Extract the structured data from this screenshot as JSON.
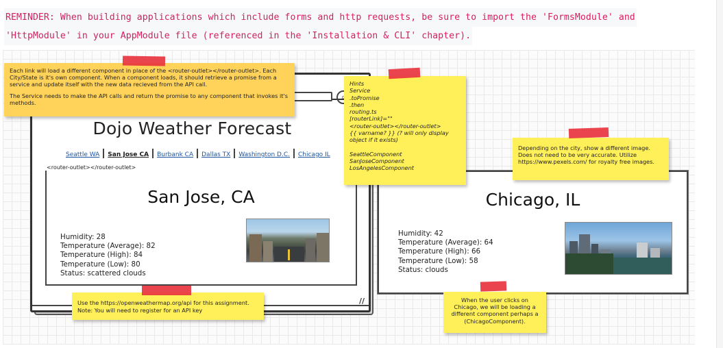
{
  "reminder": {
    "line1": "REMINDER: When building applications which include forms and http requests, be sure to import the 'FormsModule' and",
    "line2": "'HttpModule' in your AppModule file (referenced in the 'Installation & CLI' chapter)."
  },
  "wireframe": {
    "site_title": "Dojo Weather Forecast",
    "nav_links": [
      "Seattle WA",
      "San Jose CA",
      "Burbank CA",
      "Dallas TX",
      "Washington D.C.",
      "Chicago IL"
    ],
    "active_link": "San Jose CA",
    "outlet_label": "<router-outlet></router-outlet>",
    "search_glyph": "⌕",
    "resize_glyph": "//",
    "san_jose": {
      "title": "San Jose, CA",
      "humidity": "Humidity: 28",
      "temp_avg": "Temperature (Average): 82",
      "temp_high": "Temperature (High): 84",
      "temp_low": "Temperature (Low): 80",
      "status": "Status: scattered clouds"
    },
    "chicago": {
      "title": "Chicago, IL",
      "humidity": "Humidity: 42",
      "temp_avg": "Temperature (Average): 64",
      "temp_high": "Temperature (High): 66",
      "temp_low": "Temperature (Low): 58",
      "status": "Status: clouds"
    }
  },
  "notes": {
    "note1_p1": "Each link will load a different component in place of the <router-outlet></router-outlet>. Each City/State is it's own component. When a component loads, it should retrieve a promise from a service and update itself with the new data recieved from the API call.",
    "note1_p2": "The Service needs to make the API calls and return the promise to any component that invokes it's methods.",
    "hints": [
      "Hints",
      "Service",
      ".toPromise",
      ".then",
      "routing.ts",
      "[routerLink]=\"\"",
      "<router-outlet></router-outlet>",
      "{{ varname? }} (? will only display object if it exists)",
      "",
      "SeattleComponent",
      "SanJoseComponent",
      "LosAngelesComponent"
    ],
    "note3": "Depending on the city, show a different image. Does not need to be very accurate. Utilize https://www.pexels.com/ for royalty free images.",
    "note4_l1": "Use the https://openweathermap.org/api for this assignment.",
    "note4_l2": "Note: You will need to register for an API key",
    "note5": "When the user clicks on Chicago, we will be loading a different component perhaps a (ChicagoComponent)."
  },
  "colors": {
    "reminder_text": "#d81e5b",
    "sticky_yellow": "#fff05a",
    "sticky_orange": "#ffd25a",
    "tape_red": "#e8343f",
    "link_blue": "#1e55a3"
  },
  "icons": {
    "search": "search-icon",
    "resize": "resize-grip-icon"
  }
}
